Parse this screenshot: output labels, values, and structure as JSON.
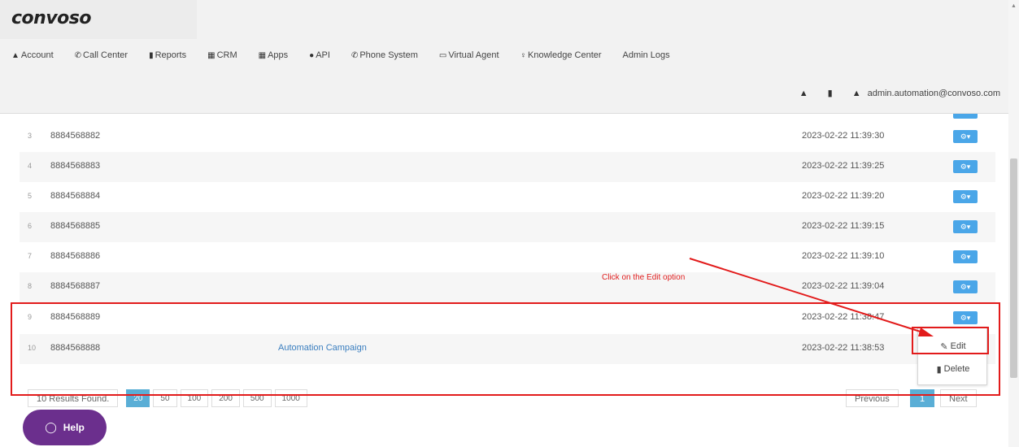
{
  "brand": {
    "logo": "convoso"
  },
  "nav": [
    {
      "icon": "▲",
      "label": "Account"
    },
    {
      "icon": "✆",
      "label": "Call Center"
    },
    {
      "icon": "▮",
      "label": "Reports"
    },
    {
      "icon": "▦",
      "label": "CRM"
    },
    {
      "icon": "▦",
      "label": "Apps"
    },
    {
      "icon": "●",
      "label": "API"
    },
    {
      "icon": "✆",
      "label": "Phone System"
    },
    {
      "icon": "▭",
      "label": "Virtual Agent"
    },
    {
      "icon": "♀",
      "label": "Knowledge Center"
    },
    {
      "icon": "",
      "label": "Admin Logs"
    }
  ],
  "user": {
    "email": "admin.automation@convoso.com"
  },
  "rows": [
    {
      "idx": "3",
      "phone": "8884568882",
      "campaign": "",
      "date": "2023-02-22 11:39:30"
    },
    {
      "idx": "4",
      "phone": "8884568883",
      "campaign": "",
      "date": "2023-02-22 11:39:25"
    },
    {
      "idx": "5",
      "phone": "8884568884",
      "campaign": "",
      "date": "2023-02-22 11:39:20"
    },
    {
      "idx": "6",
      "phone": "8884568885",
      "campaign": "",
      "date": "2023-02-22 11:39:15"
    },
    {
      "idx": "7",
      "phone": "8884568886",
      "campaign": "",
      "date": "2023-02-22 11:39:10"
    },
    {
      "idx": "8",
      "phone": "8884568887",
      "campaign": "",
      "date": "2023-02-22 11:39:04"
    },
    {
      "idx": "9",
      "phone": "8884568889",
      "campaign": "",
      "date": "2023-02-22 11:38:47"
    },
    {
      "idx": "10",
      "phone": "8884568888",
      "campaign": "Automation Campaign",
      "date": "2023-02-22 11:38:53"
    }
  ],
  "dropdown": {
    "edit": "Edit",
    "delete": "Delete"
  },
  "pagination": {
    "results": "10 Results Found.",
    "sizes": [
      "20",
      "50",
      "100",
      "200",
      "500",
      "1000"
    ],
    "active_size": "20",
    "previous": "Previous",
    "page": "1",
    "next": "Next"
  },
  "help": {
    "label": "Help"
  },
  "annotation": {
    "text": "Click on the Edit option",
    "color": "#e02020"
  },
  "colors": {
    "accent": "#4aa6e8",
    "help_purple": "#6b2f8d",
    "annotation_red": "#e21b1b"
  }
}
